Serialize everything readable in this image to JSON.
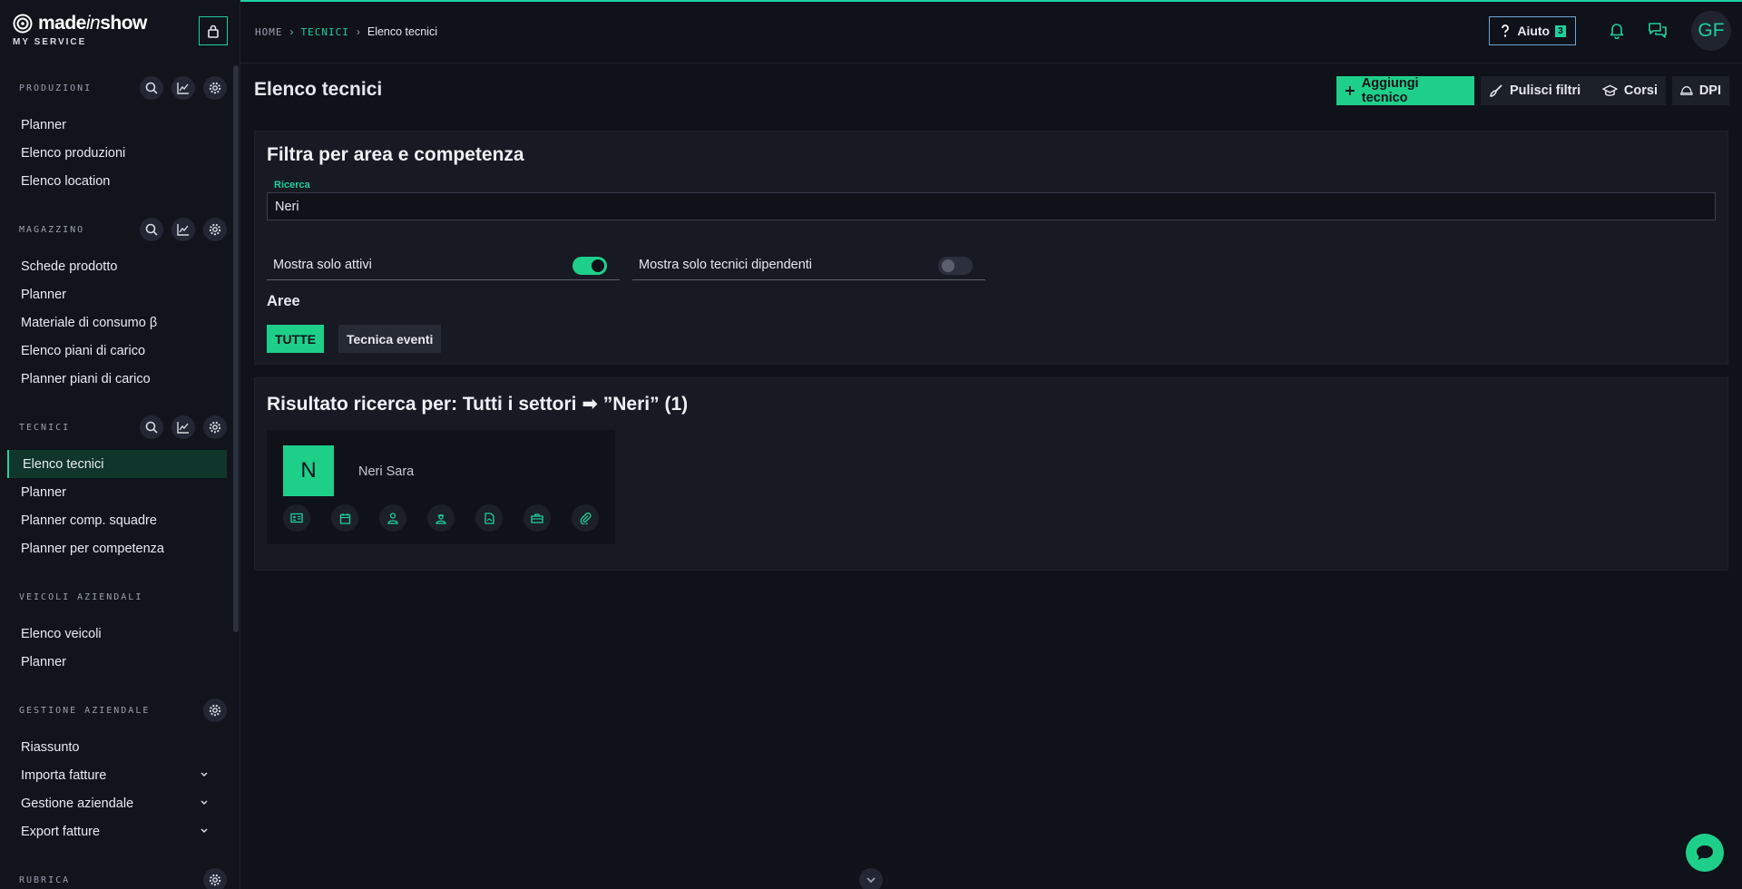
{
  "brand": {
    "name_part1": "made",
    "name_part2": "in",
    "name_part3": "show",
    "subtitle": "MY SERVICE"
  },
  "sidebar": {
    "sections": [
      {
        "title": "PRODUZIONI",
        "items": [
          "Planner",
          "Elenco produzioni",
          "Elenco location"
        ]
      },
      {
        "title": "MAGAZZINO",
        "items": [
          "Schede prodotto",
          "Planner",
          "Materiale di consumo β",
          "Elenco piani di carico",
          "Planner piani di carico"
        ]
      },
      {
        "title": "TECNICI",
        "items": [
          "Elenco tecnici",
          "Planner",
          "Planner comp. squadre",
          "Planner per competenza"
        ]
      },
      {
        "title": "VEICOLI AZIENDALI",
        "items": [
          "Elenco veicoli",
          "Planner"
        ]
      },
      {
        "title": "GESTIONE AZIENDALE",
        "items": [
          "Riassunto",
          "Importa fatture",
          "Gestione aziendale",
          "Export fatture"
        ]
      },
      {
        "title": "RUBRICA",
        "items": []
      }
    ]
  },
  "breadcrumb": {
    "home": "HOME",
    "section": "TECNICI",
    "current": "Elenco tecnici"
  },
  "header": {
    "help_label": "Aiuto",
    "help_badge": "3",
    "user_initials": "GF"
  },
  "page": {
    "title": "Elenco tecnici",
    "actions": {
      "add": "Aggiungi tecnico",
      "clear": "Pulisci filtri",
      "courses": "Corsi",
      "dpi": "DPI"
    }
  },
  "filters": {
    "title": "Filtra per area e competenza",
    "search_label": "Ricerca",
    "search_value": "Neri",
    "toggle_active_label": "Mostra solo attivi",
    "toggle_employees_label": "Mostra solo tecnici dipendenti",
    "areas_title": "Aree",
    "areas": [
      "TUTTE",
      "Tecnica eventi"
    ]
  },
  "results": {
    "title": "Risultato ricerca per: Tutti i settori ➡ ”Neri” (1)",
    "technician": {
      "initial": "N",
      "name": "Neri Sara"
    }
  },
  "colors": {
    "accent": "#1ecf8a",
    "background": "#0f1219",
    "panel": "#171a23"
  }
}
